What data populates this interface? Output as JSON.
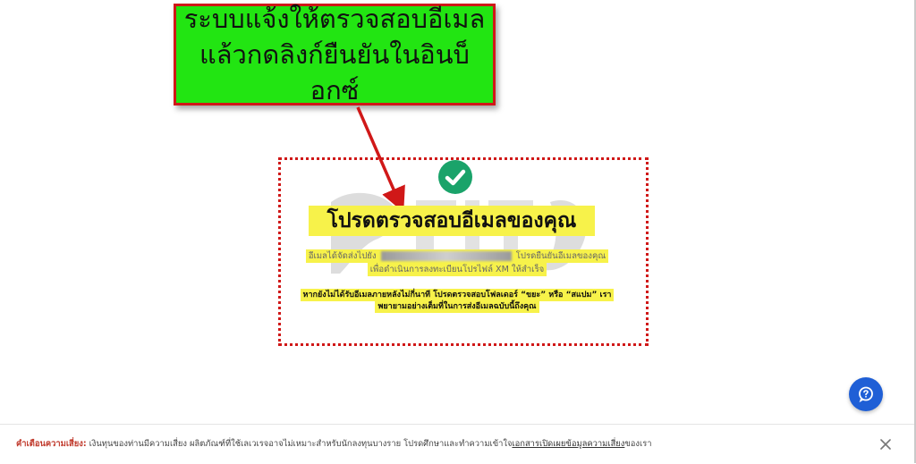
{
  "callout": {
    "line1": "ระบบแจ้งให้ตรวจสอบอีเมล",
    "line2": "แล้วกดลิงก์ยืนยันในอินบ็อกซ์"
  },
  "card": {
    "title": "โปรดตรวจสอบอีเมลของคุณ",
    "message_prefix": "อีเมลได้จัดส่งไปยัง",
    "message_suffix": "โปรดยืนยันอีเมลของคุณ",
    "message_line2": "เพื่อดำเนินการลงทะเบียนโปรไฟล์ XM ให้สำเร็จ",
    "spam_line1": "หากยังไม่ได้รับอีเมลภายหลังไม่กี่นาที โปรดตรวจสอบโฟลเดอร์ “ขยะ” หรือ “สแปม” เรา",
    "spam_line2": "พยายามอย่างเต็มที่ในการส่งอีเมลฉบับนี้ถึงคุณ"
  },
  "footer": {
    "label": "คำเตือนความเสี่ยง:",
    "text": " เงินทุนของท่านมีความเสี่ยง ผลิตภัณฑ์ที่ใช้เลเวเรจอาจไม่เหมาะสำหรับนักลงทุนบางราย โปรดศึกษาและทำความเข้าใจ",
    "link": "เอกสารเปิดเผยข้อมูลความเสี่ยง",
    "suffix": "ของเรา"
  },
  "colors": {
    "callout_bg": "#22e512",
    "annotation_red": "#d01818",
    "highlight": "#f7f24a",
    "success_green": "#1aa36a",
    "help_blue": "#1f5fd6"
  },
  "icons": {
    "success": "check-circle-icon",
    "help": "chat-help-icon",
    "close": "close-icon"
  }
}
